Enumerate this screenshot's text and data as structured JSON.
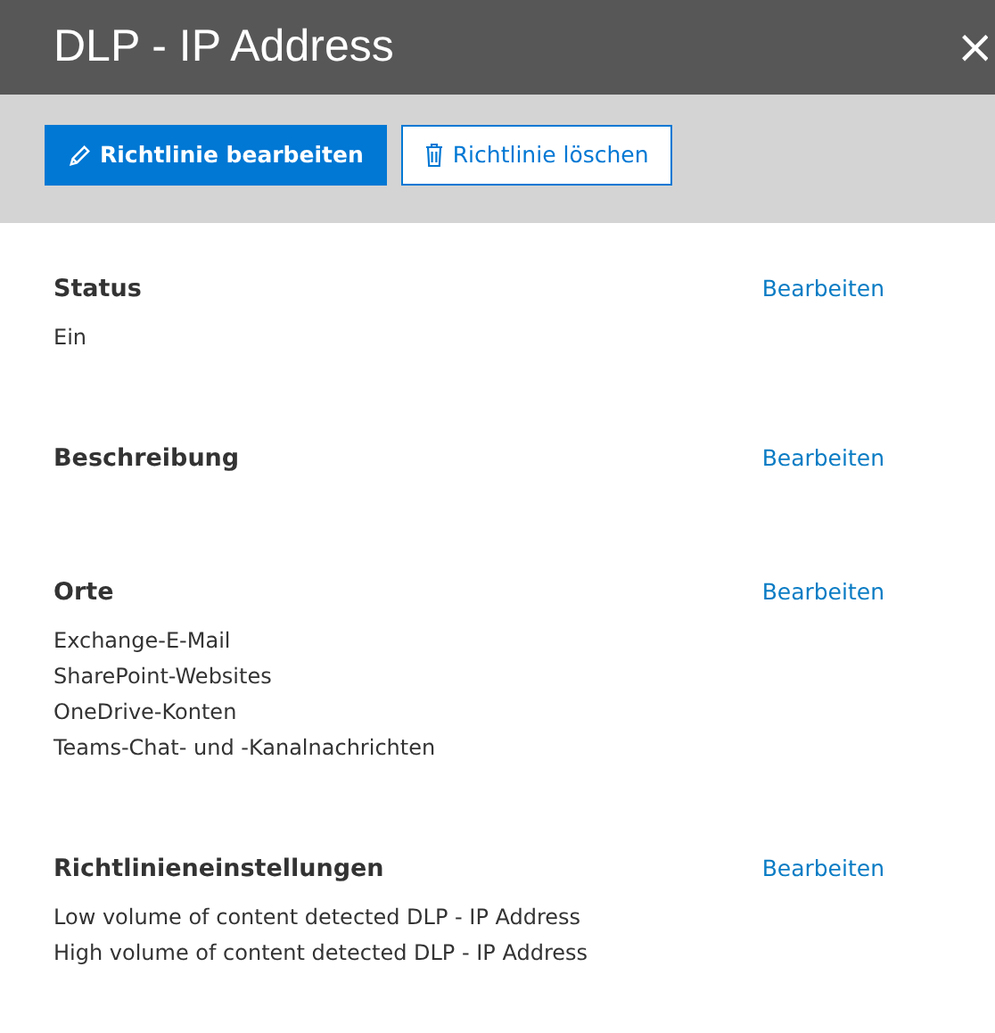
{
  "panel": {
    "title": "DLP - IP Address",
    "close": "×"
  },
  "toolbar": {
    "buttons": [
      {
        "label": "Richtlinie bearbeiten",
        "kind": "primary"
      },
      {
        "label": "Richtlinie löschen",
        "kind": "outline"
      }
    ]
  },
  "sections": [
    {
      "heading": "Status",
      "action": "Bearbeiten",
      "lines": [
        "Ein"
      ]
    },
    {
      "heading": "Beschreibung",
      "action": "Bearbeiten"
    },
    {
      "heading": "Orte",
      "action": "Bearbeiten",
      "lines": [
        "Exchange-E-Mail",
        "SharePoint-Websites",
        "OneDrive-Konten",
        "Teams-Chat- und -Kanalnachrichten"
      ]
    },
    {
      "heading": "Richtlinieneinstellungen",
      "action": "Bearbeiten",
      "lines": [
        "Low volume of content detected DLP - IP Address",
        "High volume of content detected DLP - IP Address"
      ]
    }
  ]
}
